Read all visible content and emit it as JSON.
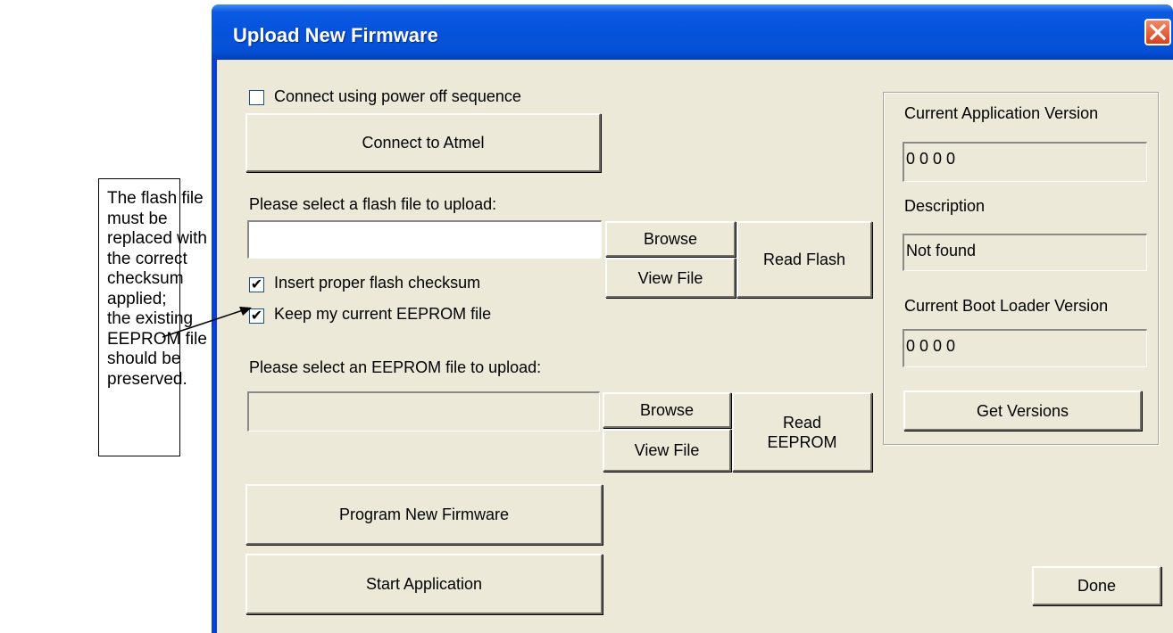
{
  "callout": {
    "lines": [
      "The flash file",
      "must be",
      "replaced with",
      "the correct",
      "checksum",
      "applied;",
      "the existing",
      "EEPROM file",
      "should be",
      "preserved."
    ]
  },
  "window": {
    "title": "Upload New Firmware"
  },
  "connection": {
    "power_off_label": "Connect using power off sequence",
    "power_off_checked": false,
    "connect_button": "Connect to Atmel"
  },
  "flash": {
    "prompt": "Please select a flash file to upload:",
    "file_value": "",
    "browse_button": "Browse",
    "view_button": "View File",
    "read_button": "Read Flash",
    "checksum_label": "Insert proper flash checksum",
    "checksum_checked": true,
    "keep_eeprom_label": "Keep my current EEPROM file",
    "keep_eeprom_checked": true
  },
  "eeprom": {
    "prompt": "Please select an EEPROM file to upload:",
    "file_value": "",
    "browse_button": "Browse",
    "view_button": "View File",
    "read_button_line1": "Read",
    "read_button_line2": "EEPROM"
  },
  "actions": {
    "program_button": "Program New Firmware",
    "start_button": "Start Application",
    "done_button": "Done"
  },
  "versions": {
    "app_label": "Current Application Version",
    "app_value": "0 0 0 0",
    "description_label": "Description",
    "description_value": "Not found",
    "boot_label": "Current Boot Loader Version",
    "boot_value": "0 0 0 0",
    "get_button": "Get Versions"
  },
  "colors": {
    "titlebar": "#0653db",
    "dialog_bg": "#ece9d8",
    "close_button": "#d9401c"
  }
}
